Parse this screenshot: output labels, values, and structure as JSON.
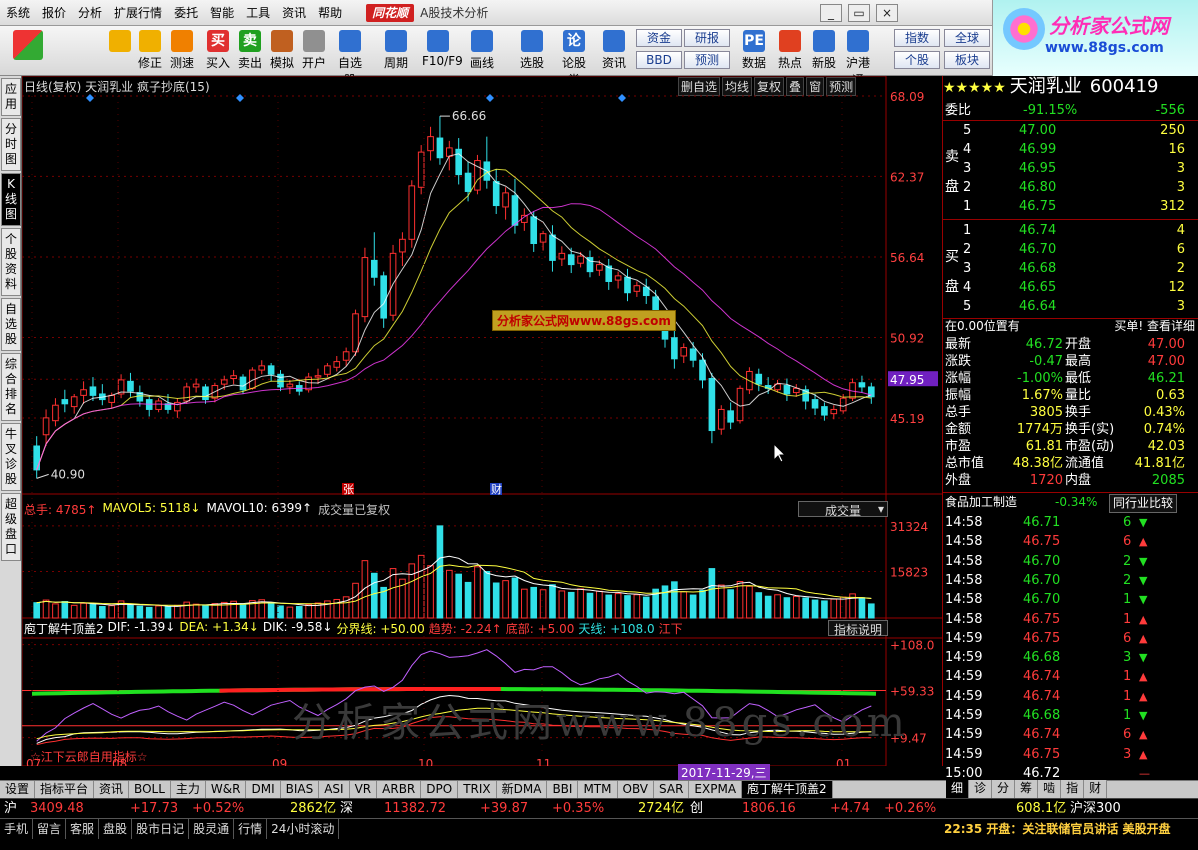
{
  "menu": [
    "系统",
    "报价",
    "分析",
    "扩展行情",
    "委托",
    "智能",
    "工具",
    "资讯",
    "帮助"
  ],
  "brand": "同花顺",
  "app_title": "A股技术分析",
  "logo": {
    "line1": "分析家公式网",
    "line2": "www.88gs.com"
  },
  "toolbar": [
    {
      "label": "",
      "icon": "grid-icon",
      "color": "#ff3030"
    },
    {
      "label": "",
      "icon": "back-arrow-icon",
      "color": "#f0b000"
    },
    {
      "label": "修正",
      "icon": "up-down-icon",
      "color": "#f0b000"
    },
    {
      "label": "测速",
      "icon": "timer-icon",
      "color": "#f08000"
    },
    {
      "label": "买入",
      "icon": "buy-icon",
      "color": "#e03030",
      "glyph": "买"
    },
    {
      "label": "卖出",
      "icon": "sell-icon",
      "color": "#20a020",
      "glyph": "卖"
    },
    {
      "label": "模拟",
      "icon": "hammer-icon",
      "color": "#c06020"
    },
    {
      "label": "开户",
      "icon": "lock-icon",
      "color": "#909090"
    },
    {
      "label": "自选股",
      "icon": "star-icon",
      "color": "#3070d0"
    },
    {
      "label": "周期",
      "icon": "clock-icon",
      "color": "#3070d0"
    },
    {
      "label": "F10/F9",
      "icon": "f10-icon",
      "color": "#3070d0"
    },
    {
      "label": "画线",
      "icon": "pen-icon",
      "color": "#3070d0"
    },
    {
      "label": "选股",
      "icon": "screen-icon",
      "color": "#3070d0"
    },
    {
      "label": "论股堂",
      "icon": "talk-icon",
      "color": "#3070d0",
      "glyph": "论"
    },
    {
      "label": "资讯",
      "icon": "news-icon",
      "color": "#3070d0"
    },
    {
      "label": "数据",
      "icon": "pe-icon",
      "color": "#3070d0",
      "glyph": "PE"
    },
    {
      "label": "热点",
      "icon": "fire-icon",
      "color": "#e04020"
    },
    {
      "label": "新股",
      "icon": "ipo-icon",
      "color": "#3070d0"
    },
    {
      "label": "沪港通",
      "icon": "hk-icon",
      "color": "#3070d0"
    }
  ],
  "toolbar_text_buttons": [
    "资金",
    "研报",
    "BBD",
    "预测",
    "指数",
    "全球",
    "个股",
    "板块"
  ],
  "left_tabs": [
    "应用",
    "分时图",
    "K线图",
    "个股资料",
    "自选股",
    "综合排名",
    "牛叉诊股",
    "超级盘口"
  ],
  "chart_header": "日线(复权) 天润乳业 疯子抄底(15)",
  "chart_header_right": [
    "删自选",
    "均线",
    "复权",
    "叠",
    "窗",
    "预测"
  ],
  "price_axis": [
    "68.09",
    "62.37",
    "56.64",
    "50.92",
    "47.95",
    "45.19"
  ],
  "price_marks": {
    "high": "66.66",
    "low": "40.90"
  },
  "event_marks": [
    "张",
    "财"
  ],
  "volume_header": {
    "total": "总手: 4785↑",
    "ma5": "MAVOL5: 5118↓",
    "ma10": "MAVOL10: 6399↑",
    "note": "成交量已复权",
    "dropdown": "成交量"
  },
  "volume_axis": [
    "31324",
    "15823"
  ],
  "ind_header": {
    "name": "庖丁解牛顶盖2",
    "dif": "DIF: -1.39↓",
    "dea": "DEA: +1.34↓",
    "dik": "DIK: -9.58↓",
    "fen": "分界线: +50.00",
    "qs": "趋势: -2.24↑",
    "db": "底部: +5.00",
    "tx": "天线: +108.0",
    "jx": "江下",
    "button": "指标说明"
  },
  "ind_axis": [
    "+108.0",
    "+59.33",
    "+9.47"
  ],
  "ind_footer": "☆江下云郎自用指标☆",
  "xaxis": [
    "07",
    "08",
    "09",
    "10",
    "11",
    "01"
  ],
  "date_marker": "2017-11-29,三",
  "watermark_text": "分析家公式网www.88gs.com",
  "stamp_text": "分析家公式网www.88gs.com",
  "stock": {
    "stars": "★★★★★",
    "name": "天润乳业",
    "code": "600419"
  },
  "weibi": {
    "label": "委比",
    "pct": "-91.15%",
    "diff": "-556"
  },
  "sell": [
    [
      "5",
      "47.00",
      "250"
    ],
    [
      "4",
      "46.99",
      "16"
    ],
    [
      "3",
      "46.95",
      "3"
    ],
    [
      "2",
      "46.80",
      "3"
    ],
    [
      "1",
      "46.75",
      "312"
    ]
  ],
  "buy": [
    [
      "1",
      "46.74",
      "4"
    ],
    [
      "2",
      "46.70",
      "6"
    ],
    [
      "3",
      "46.68",
      "2"
    ],
    [
      "4",
      "46.65",
      "12"
    ],
    [
      "5",
      "46.64",
      "3"
    ]
  ],
  "side_labels": {
    "sell1": "卖",
    "sell2": "盘",
    "buy1": "买",
    "buy2": "盘"
  },
  "pos_note": {
    "left": "在0.00位置有",
    "right": "买单! 查看详细"
  },
  "quote": [
    [
      "最新",
      "46.72",
      "开盘",
      "47.00"
    ],
    [
      "涨跌",
      "-0.47",
      "最高",
      "47.00"
    ],
    [
      "涨幅",
      "-1.00%",
      "最低",
      "46.21"
    ],
    [
      "振幅",
      "1.67%",
      "量比",
      "0.63"
    ],
    [
      "总手",
      "3805",
      "换手",
      "0.43%"
    ],
    [
      "金额",
      "1774万",
      "换手(实)",
      "0.74%"
    ],
    [
      "市盈",
      "61.81",
      "市盈(动)",
      "42.03"
    ],
    [
      "总市值",
      "48.38亿",
      "流通值",
      "41.81亿"
    ],
    [
      "外盘",
      "1720",
      "内盘",
      "2085"
    ]
  ],
  "industry": {
    "name": "食品加工制造",
    "pct": "-0.34%",
    "button": "同行业比较"
  },
  "ticks": [
    [
      "14:58",
      "46.71",
      "6",
      "dn"
    ],
    [
      "14:58",
      "46.75",
      "6",
      "up"
    ],
    [
      "14:58",
      "46.70",
      "2",
      "dn"
    ],
    [
      "14:58",
      "46.70",
      "2",
      "dn"
    ],
    [
      "14:58",
      "46.70",
      "1",
      "dn"
    ],
    [
      "14:58",
      "46.75",
      "1",
      "up"
    ],
    [
      "14:59",
      "46.75",
      "6",
      "up"
    ],
    [
      "14:59",
      "46.68",
      "3",
      "dn"
    ],
    [
      "14:59",
      "46.74",
      "1",
      "up"
    ],
    [
      "14:59",
      "46.74",
      "1",
      "up"
    ],
    [
      "14:59",
      "46.68",
      "1",
      "dn"
    ],
    [
      "14:59",
      "46.74",
      "6",
      "up"
    ],
    [
      "14:59",
      "46.75",
      "3",
      "up"
    ],
    [
      "15:00",
      "46.72",
      "",
      "eq"
    ]
  ],
  "right_tabs": [
    "细",
    "诊",
    "分",
    "筹",
    "啮",
    "指",
    "财"
  ],
  "bottom_tabs": [
    "设置",
    "指标平台",
    "资讯",
    "BOLL",
    "主力",
    "W&R",
    "DMI",
    "BIAS",
    "ASI",
    "VR",
    "ARBR",
    "DPO",
    "TRIX",
    "新DMA",
    "BBI",
    "MTM",
    "OBV",
    "SAR",
    "EXPMA",
    "庖丁解牛顶盖2"
  ],
  "market": {
    "sh": "沪",
    "sh_val": "3409.48",
    "sh_chg": "+17.73",
    "sh_pct": "+0.52%",
    "sh_amt": "2862亿",
    "sz": "深",
    "sz_val": "11382.72",
    "sz_chg": "+39.87",
    "sz_pct": "+0.35%",
    "sz_amt": "2724亿",
    "cy": "创",
    "cy_val": "1806.16",
    "cy_chg": "+4.74",
    "cy_pct": "+0.26%",
    "hs_amt": "608.1亿",
    "hs": "沪深300"
  },
  "status_items": [
    "手机",
    "留言",
    "客服",
    "盘股",
    "股市日记",
    "股灵通",
    "行情",
    "24小时滚动"
  ],
  "news": "22:35 开盘：关注联储官员讲话 美股开盘",
  "chart_data": {
    "type": "candlestick",
    "title": "天润乳业 日线(复权)",
    "ylim": [
      40,
      68.09
    ],
    "x_labels": [
      "07",
      "08",
      "09",
      "10",
      "11",
      "01"
    ],
    "candles": [
      [
        43.2,
        43.9,
        41.5,
        40.9
      ],
      [
        44,
        45.8,
        45.2,
        43.2
      ],
      [
        45,
        46.6,
        46.1,
        44.6
      ],
      [
        46.5,
        47.2,
        46.2,
        45.6
      ],
      [
        46,
        46.9,
        46.7,
        45.5
      ],
      [
        46.8,
        47.8,
        47.2,
        46.2
      ],
      [
        47.4,
        48.1,
        46.8,
        46.4
      ],
      [
        46.9,
        47.6,
        46.5,
        46.1
      ],
      [
        46.3,
        47,
        46.8,
        45.9
      ],
      [
        46.9,
        48.3,
        47.9,
        46.6
      ],
      [
        47.8,
        48.4,
        47.1,
        46.7
      ],
      [
        47,
        47.5,
        46.4,
        46
      ],
      [
        46.5,
        46.8,
        45.8,
        45.3
      ],
      [
        45.8,
        46.6,
        46.4,
        45.6
      ],
      [
        46.2,
        46.9,
        45.8,
        45.5
      ],
      [
        45.7,
        46.6,
        46.3,
        45.2
      ],
      [
        46.4,
        47.7,
        47.4,
        46.2
      ],
      [
        47.4,
        48,
        47.6,
        47
      ],
      [
        47.4,
        47.6,
        46.5,
        46.2
      ],
      [
        46.6,
        47.7,
        47.5,
        46.3
      ],
      [
        47.6,
        48.2,
        47.9,
        47.2
      ],
      [
        48,
        48.6,
        48.2,
        47.6
      ],
      [
        48.1,
        48.3,
        47.2,
        46.9
      ],
      [
        47.3,
        48.8,
        48.6,
        47.2
      ],
      [
        48.6,
        49.3,
        48.9,
        48.3
      ],
      [
        48.9,
        49.1,
        48.3,
        47.8
      ],
      [
        48.3,
        48.6,
        47.4,
        47.1
      ],
      [
        47.4,
        47.9,
        47.6,
        46.9
      ],
      [
        47.5,
        47.8,
        47.1,
        46.8
      ],
      [
        47.2,
        48.4,
        48.1,
        47
      ],
      [
        48.1,
        48.7,
        48.2,
        47.6
      ],
      [
        48.3,
        49.1,
        48.9,
        48.1
      ],
      [
        48.8,
        49.6,
        49.2,
        48.5
      ],
      [
        49.3,
        50.2,
        49.9,
        48.9
      ],
      [
        49.9,
        52.9,
        52.6,
        49.6
      ],
      [
        52.4,
        57.3,
        56.6,
        52
      ],
      [
        56.4,
        58.4,
        55.2,
        54.6
      ],
      [
        55.3,
        55.6,
        52.3,
        51.6
      ],
      [
        52.5,
        57.5,
        56.9,
        52.1
      ],
      [
        57,
        58.4,
        57.9,
        56
      ],
      [
        57.9,
        62.1,
        61.7,
        57.3
      ],
      [
        61.6,
        64.6,
        64.1,
        61.1
      ],
      [
        64.2,
        65.9,
        65.2,
        63.5
      ],
      [
        65.1,
        66.66,
        63.7,
        63.2
      ],
      [
        63.8,
        64.9,
        64.4,
        62.8
      ],
      [
        64.3,
        65.1,
        62.5,
        61.8
      ],
      [
        62.6,
        63.4,
        61.3,
        60.6
      ],
      [
        61.4,
        63.9,
        63.5,
        61.1
      ],
      [
        63.4,
        65.2,
        62.1,
        61.5
      ],
      [
        62,
        62.9,
        60.3,
        59.7
      ],
      [
        60.2,
        61.6,
        61.2,
        59.3
      ],
      [
        61,
        62.2,
        58.9,
        58.3
      ],
      [
        59.1,
        60.1,
        59.6,
        58.5
      ],
      [
        59.5,
        59.9,
        57.6,
        57
      ],
      [
        57.7,
        58.5,
        58.3,
        57.1
      ],
      [
        58.2,
        58.9,
        56.4,
        55.6
      ],
      [
        56.5,
        57.4,
        56.9,
        56
      ],
      [
        56.8,
        57.3,
        56.1,
        55.5
      ],
      [
        56.2,
        57,
        56.7,
        55.9
      ],
      [
        56.6,
        57.1,
        55.6,
        55.2
      ],
      [
        55.7,
        56.4,
        56.1,
        55.3
      ],
      [
        56,
        56.5,
        54.9,
        54.3
      ],
      [
        55,
        55.6,
        55.3,
        54.4
      ],
      [
        55.2,
        55.8,
        54.1,
        53.5
      ],
      [
        54.2,
        54.9,
        54.6,
        53.8
      ],
      [
        54.5,
        55.1,
        53.9,
        53.3
      ],
      [
        53.8,
        54.3,
        52.1,
        51.4
      ],
      [
        52.2,
        52.8,
        50.8,
        50.2
      ],
      [
        50.9,
        51.5,
        49.4,
        48.7
      ],
      [
        49.6,
        50.5,
        50.2,
        49.1
      ],
      [
        50.1,
        50.6,
        49.3,
        48.8
      ],
      [
        49.3,
        49.8,
        47.9,
        47.3
      ],
      [
        48,
        48.4,
        44.3,
        43.4
      ],
      [
        44.4,
        46.1,
        45.8,
        44
      ],
      [
        45.7,
        46.3,
        44.9,
        44.4
      ],
      [
        45,
        47.5,
        47.3,
        44.8
      ],
      [
        47.2,
        48.8,
        48.5,
        46.9
      ],
      [
        48.3,
        48.7,
        47.6,
        47.1
      ],
      [
        47.5,
        48.1,
        47.3,
        46.9
      ],
      [
        47.2,
        47.9,
        47.6,
        47
      ],
      [
        47.5,
        48,
        46.9,
        46.4
      ],
      [
        47,
        47.6,
        47.3,
        46.7
      ],
      [
        47.2,
        47.5,
        46.4,
        45.8
      ],
      [
        46.5,
        46.9,
        45.9,
        45.4
      ],
      [
        46,
        46.3,
        45.4,
        45
      ],
      [
        45.5,
        46.1,
        45.8,
        45.1
      ],
      [
        45.7,
        46.9,
        46.6,
        45.5
      ],
      [
        46.6,
        48,
        47.7,
        46.4
      ],
      [
        47.7,
        48.2,
        47.4,
        47
      ],
      [
        47.4,
        47.7,
        46.7,
        46.2
      ]
    ],
    "volume": {
      "ylim": [
        0,
        34000
      ],
      "values": [
        5200,
        6100,
        4800,
        5600,
        4300,
        5000,
        4600,
        3900,
        4200,
        5800,
        4500,
        4000,
        3600,
        4100,
        3800,
        4300,
        5400,
        4700,
        4100,
        4900,
        5300,
        5700,
        4400,
        5900,
        6200,
        4800,
        4100,
        3700,
        3900,
        4600,
        5100,
        5800,
        6300,
        7200,
        11800,
        19500,
        15200,
        10400,
        16800,
        13200,
        18400,
        21300,
        17800,
        31324,
        16200,
        14900,
        12100,
        17400,
        15800,
        11900,
        12700,
        13600,
        9800,
        10400,
        9600,
        11300,
        9200,
        8700,
        9900,
        8400,
        9100,
        7800,
        8300,
        7600,
        7900,
        7100,
        9800,
        10900,
        12300,
        8900,
        7800,
        9400,
        16800,
        11200,
        9600,
        12400,
        10800,
        8600,
        7400,
        7900,
        6900,
        7300,
        6800,
        6100,
        5800,
        6400,
        7100,
        8200,
        6900,
        4785
      ]
    },
    "indicator": {
      "name": "庖丁解牛顶盖2",
      "ylim": [
        -10,
        115
      ],
      "lines": [
        "DIF",
        "DEA",
        "DIK",
        "分界线",
        "趋势",
        "底部",
        "天线"
      ]
    }
  }
}
